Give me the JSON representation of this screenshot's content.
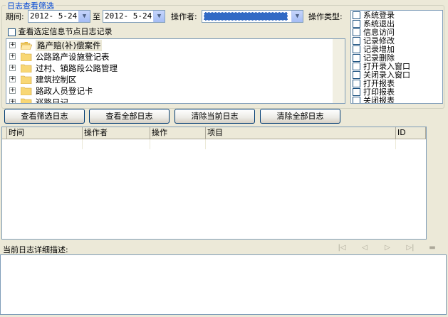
{
  "filter_group": {
    "title": "日志查看筛选",
    "period_label": "期间:",
    "date_from": "2012- 5-24",
    "to_label": "至",
    "date_to": "2012- 5-24",
    "operator_label": "操作者:",
    "operator_value": "",
    "optype_label": "操作类型:",
    "node_checkbox_label": "查看选定信息节点日志记录"
  },
  "tree_items": [
    {
      "label": "路产赔(补)偿案件",
      "open": true
    },
    {
      "label": "公路路产设施登记表",
      "open": false
    },
    {
      "label": "过村、镇路段公路管理",
      "open": false
    },
    {
      "label": "建筑控制区",
      "open": false
    },
    {
      "label": "路政人员登记卡",
      "open": false
    },
    {
      "label": "巡路日记",
      "open": false
    }
  ],
  "op_types": [
    "系统登录",
    "系统退出",
    "信息访问",
    "记录修改",
    "记录增加",
    "记录删除",
    "打开录入窗口",
    "关闭录入窗口",
    "打开报表",
    "打印报表",
    "关闭报表"
  ],
  "buttons": {
    "view_filtered": "查看筛选日志",
    "view_all": "查看全部日志",
    "clear_current": "清除当前日志",
    "clear_all": "清除全部日志"
  },
  "table": {
    "columns": [
      "时间",
      "操作者",
      "操作",
      "项目",
      "ID"
    ]
  },
  "detail_label": "当前日志详细描述:",
  "nav_icons": [
    "first-icon",
    "prev-icon",
    "next-icon",
    "last-icon",
    "minimize-icon"
  ],
  "colors": {
    "group_title": "#0046d5",
    "operator_selected": "#316ac5",
    "window_bg": "#ece9d8"
  }
}
